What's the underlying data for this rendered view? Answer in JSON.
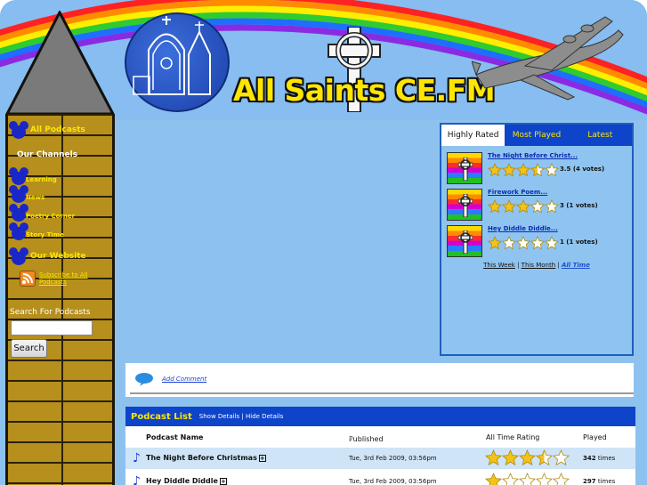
{
  "site": {
    "title": "All Saints CE.FM"
  },
  "nav": {
    "all_podcasts": "All Podcasts",
    "channels_heading": "Our Channels",
    "channels": [
      "Learning",
      "News",
      "Poetry Corner",
      "Story Time"
    ],
    "website": "Our Website",
    "subscribe": "Subscribe to All Podcasts",
    "search_label": "Search For Podcasts",
    "search_placeholder": "",
    "search_button": "Search"
  },
  "widget": {
    "tabs": [
      "Highly Rated",
      "Most Played",
      "Latest"
    ],
    "active_tab": "Highly Rated",
    "items": [
      {
        "title": "The Night Before Christ...",
        "rating": 3.5,
        "votes": "3.5 (4 votes)"
      },
      {
        "title": "Firework Poem...",
        "rating": 3,
        "votes": "3 (1 votes)"
      },
      {
        "title": "Hey Diddle Diddle...",
        "rating": 1,
        "votes": "1 (1 votes)"
      }
    ],
    "filters": {
      "week": "This Week",
      "month": "This Month",
      "all": "All Time",
      "sep": "|"
    }
  },
  "comment": {
    "label": "Add Comment"
  },
  "podcast_list": {
    "title": "Podcast List",
    "show_details": "Show Details",
    "hide_details": "Hide Details",
    "columns": {
      "name": "Podcast Name",
      "published": "Published",
      "rating": "All Time Rating",
      "played": "Played"
    },
    "rows": [
      {
        "name": "The Night Before Christmas",
        "published": "Tue, 3rd Feb 2009, 03:56pm",
        "rating": 3.5,
        "plays": "342",
        "times": "times"
      },
      {
        "name": "Hey Diddle Diddle",
        "published": "Tue, 3rd Feb 2009, 03:56pm",
        "rating": 1,
        "plays": "297",
        "times": "times"
      }
    ]
  },
  "colors": {
    "accent_blue": "#0d44c9",
    "nav_yellow": "#ffe600",
    "sky": "#8ec2ee"
  }
}
